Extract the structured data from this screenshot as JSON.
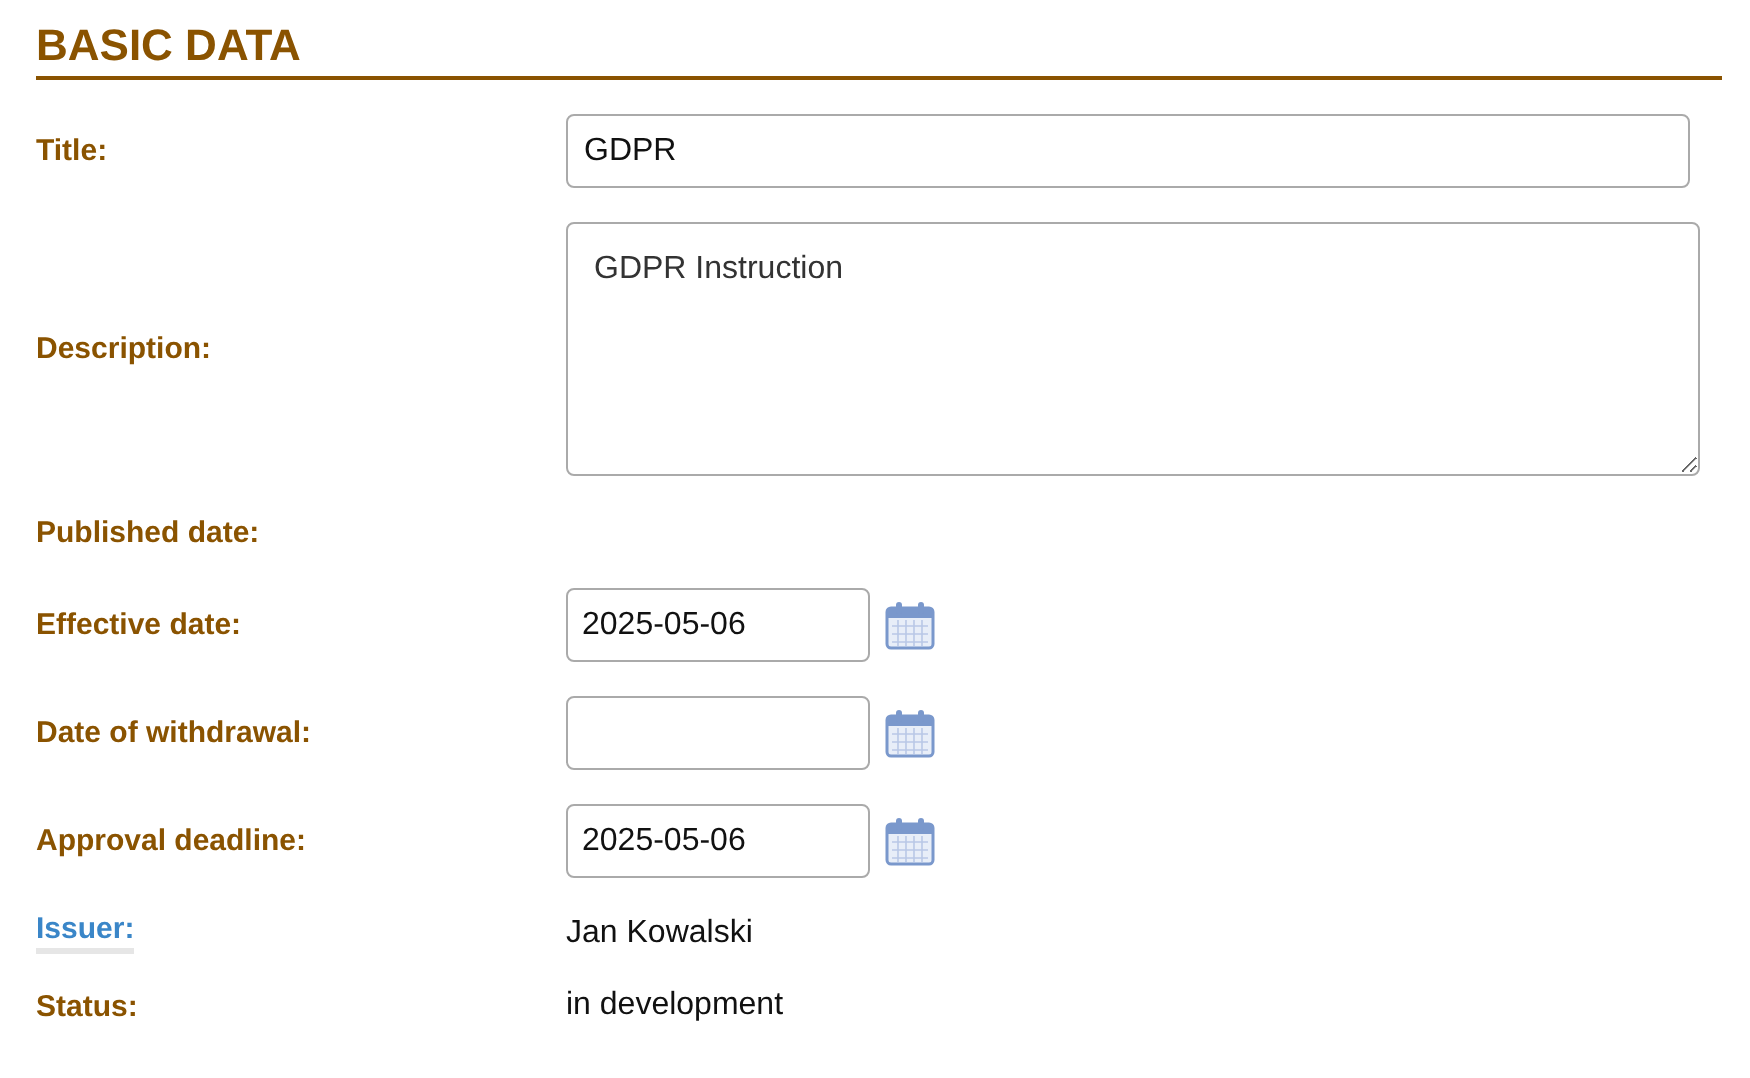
{
  "section": {
    "title": "BASIC DATA"
  },
  "rows": [
    {
      "label": "Title:",
      "label_is_link": false,
      "kind": "text",
      "value": "GDPR"
    },
    {
      "label": "Description:",
      "label_is_link": false,
      "kind": "textarea",
      "value": "GDPR Instruction"
    },
    {
      "label": "Published date:",
      "label_is_link": false,
      "kind": "none"
    },
    {
      "label": "Effective date:",
      "label_is_link": false,
      "kind": "date",
      "value": "2025-05-06"
    },
    {
      "label": "Date of withdrawal:",
      "label_is_link": false,
      "kind": "date"
    },
    {
      "label": "Approval deadline:",
      "label_is_link": false,
      "kind": "date",
      "value": "2025-05-06"
    },
    {
      "label": "Issuer:",
      "label_is_link": true,
      "kind": "plain",
      "value": "Jan Kowalski"
    },
    {
      "label": "Status:",
      "label_is_link": false,
      "kind": "plain",
      "value": "in development"
    }
  ]
}
